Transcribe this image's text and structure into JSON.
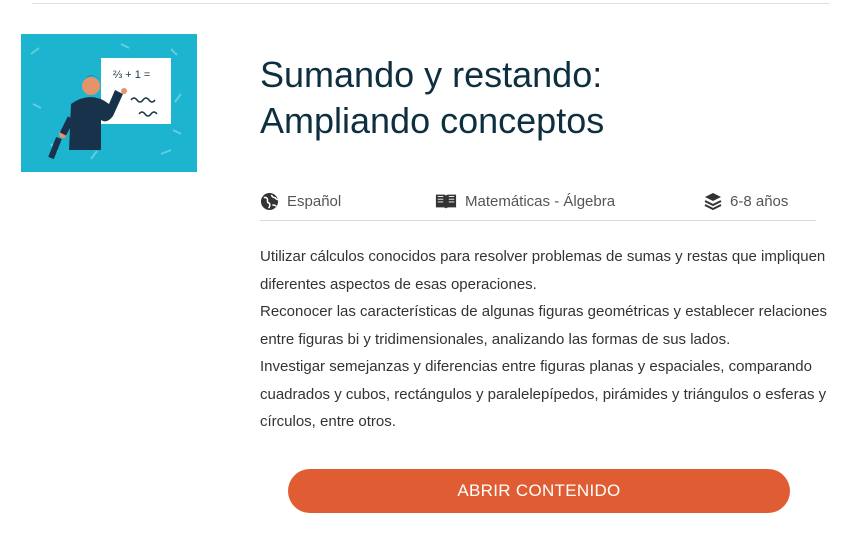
{
  "course": {
    "title_line1": "Sumando y restando:",
    "title_line2": "Ampliando conceptos",
    "thumbnail": {
      "alt": "teacher-pointing-at-whiteboard",
      "board_text": "⅔ + 1 ="
    },
    "meta": {
      "language": "Español",
      "subject": "Matemáticas - Álgebra",
      "age": "6-8 años"
    },
    "description": [
      "Utilizar cálculos conocidos para resolver problemas de sumas y restas que impliquen diferentes aspectos de esas operaciones.",
      "Reconocer las características de algunas figuras geométricas y establecer relaciones entre figuras bi y tridimensionales, analizando las formas de sus lados.",
      "Investigar semejanzas y diferencias entre figuras planas y espaciales, comparando cuadrados y cubos, rectángulos y paralelepípedos, pirámides y triángulos o esferas y círculos, entre otros."
    ],
    "open_button": "ABRIR CONTENIDO"
  },
  "colors": {
    "title": "#0e2f3f",
    "thumbnail_bg": "#1db4cf",
    "button_bg": "#e05d33",
    "button_text": "#ffffff"
  },
  "icons": {
    "language": "globe-icon",
    "subject": "book-icon",
    "age": "layers-icon"
  }
}
